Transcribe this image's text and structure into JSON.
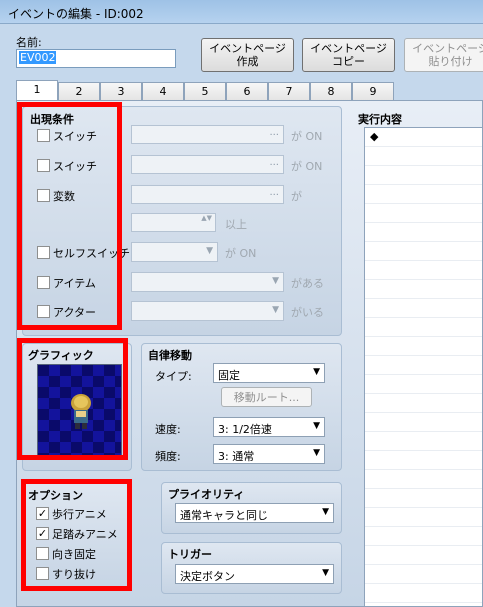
{
  "window": {
    "title": "イベントの編集 - ID:002"
  },
  "name_field": {
    "label": "名前:",
    "value": "EV002"
  },
  "toolbar": {
    "new_page": "イベントページ\n作成",
    "copy_page": "イベントページ\nコピー",
    "paste_page": "イベントページ\n貼り付け"
  },
  "tabs": [
    "1",
    "2",
    "3",
    "4",
    "5",
    "6",
    "7",
    "8",
    "9"
  ],
  "conditions": {
    "title": "出現条件",
    "switch1": {
      "label": "スイッチ",
      "suffix": "が ON"
    },
    "switch2": {
      "label": "スイッチ",
      "suffix": "が ON"
    },
    "variable": {
      "label": "変数",
      "suffix": "が",
      "spin_suffix": "以上"
    },
    "self_switch": {
      "label": "セルフスイッチ",
      "suffix": "が ON"
    },
    "item": {
      "label": "アイテム",
      "suffix": "がある"
    },
    "actor": {
      "label": "アクター",
      "suffix": "がいる"
    },
    "ellipsis": "...",
    "dropdown_arrow": "▼",
    "spin_arrows": "▲▼"
  },
  "graphic": {
    "title": "グラフィック"
  },
  "autonomous": {
    "title": "自律移動",
    "type_label": "タイプ:",
    "type_value": "固定",
    "route_button": "移動ルート...",
    "speed_label": "速度:",
    "speed_value": "3: 1/2倍速",
    "freq_label": "頻度:",
    "freq_value": "3: 通常"
  },
  "options": {
    "title": "オプション",
    "walking": {
      "label": "歩行アニメ",
      "checked": true
    },
    "stepping": {
      "label": "足踏みアニメ",
      "checked": true
    },
    "direction_fix": {
      "label": "向き固定",
      "checked": false
    },
    "through": {
      "label": "すり抜け",
      "checked": false
    },
    "check_mark": "✓"
  },
  "priority": {
    "title": "プライオリティ",
    "value": "通常キャラと同じ"
  },
  "trigger": {
    "title": "トリガー",
    "value": "決定ボタン"
  },
  "contents": {
    "title": "実行内容",
    "first_line": "◆"
  },
  "colors": {
    "highlight": "#ff0000",
    "selection": "#3399ff"
  }
}
